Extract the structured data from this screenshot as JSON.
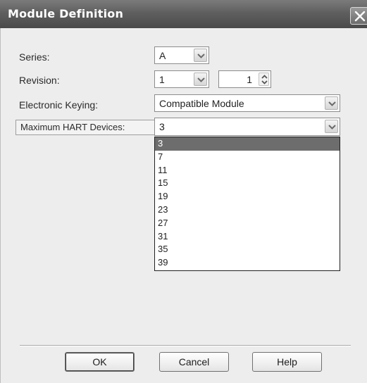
{
  "window": {
    "title": "Module Definition",
    "close_icon": "close-icon"
  },
  "form": {
    "series": {
      "label": "Series:",
      "value": "A"
    },
    "revision": {
      "label": "Revision:",
      "major": "1",
      "minor": "1"
    },
    "electronic_keying": {
      "label": "Electronic Keying:",
      "value": "Compatible Module"
    },
    "max_hart_devices": {
      "label": "Maximum HART Devices:",
      "value": "3",
      "options": [
        "3",
        "7",
        "11",
        "15",
        "19",
        "23",
        "27",
        "31",
        "35",
        "39"
      ],
      "selected_index": 0
    }
  },
  "buttons": {
    "ok": "OK",
    "cancel": "Cancel",
    "help": "Help"
  }
}
